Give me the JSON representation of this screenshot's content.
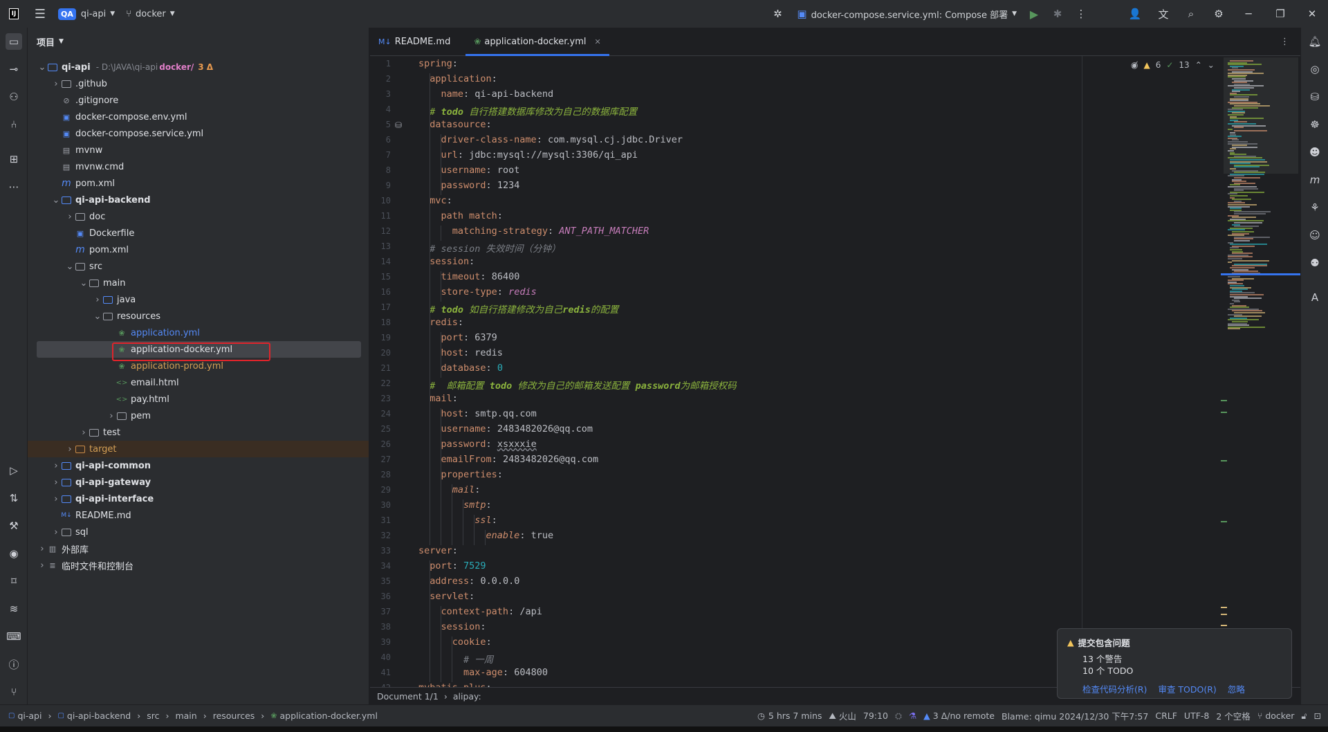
{
  "titlebar": {
    "project_badge": "QA",
    "project_name": "qi-api",
    "branch": "docker",
    "run_config": "docker-compose.service.yml: Compose 部署"
  },
  "project_panel": {
    "title": "项目",
    "tree": [
      {
        "label": "qi-api",
        "suffix": "- D:\\JAVA\\qi-api",
        "branch": "docker/",
        "delta": "3 Δ",
        "depth": 0,
        "expanded": true,
        "kind": "module"
      },
      {
        "label": ".github",
        "depth": 1,
        "kind": "folder"
      },
      {
        "label": ".gitignore",
        "depth": 1,
        "kind": "ignore"
      },
      {
        "label": "docker-compose.env.yml",
        "depth": 1,
        "kind": "docker"
      },
      {
        "label": "docker-compose.service.yml",
        "depth": 1,
        "kind": "docker"
      },
      {
        "label": "mvnw",
        "depth": 1,
        "kind": "shell"
      },
      {
        "label": "mvnw.cmd",
        "depth": 1,
        "kind": "shell"
      },
      {
        "label": "pom.xml",
        "depth": 1,
        "kind": "maven"
      },
      {
        "label": "qi-api-backend",
        "depth": 1,
        "expanded": true,
        "kind": "module"
      },
      {
        "label": "doc",
        "depth": 2,
        "kind": "folder"
      },
      {
        "label": "Dockerfile",
        "depth": 2,
        "kind": "docker"
      },
      {
        "label": "pom.xml",
        "depth": 2,
        "kind": "maven"
      },
      {
        "label": "src",
        "depth": 2,
        "expanded": true,
        "kind": "folder"
      },
      {
        "label": "main",
        "depth": 3,
        "expanded": true,
        "kind": "folder"
      },
      {
        "label": "java",
        "depth": 4,
        "kind": "folder-src"
      },
      {
        "label": "resources",
        "depth": 4,
        "expanded": true,
        "kind": "folder-res"
      },
      {
        "label": "application.yml",
        "depth": 5,
        "kind": "yml",
        "color": "blue"
      },
      {
        "label": "application-docker.yml",
        "depth": 5,
        "kind": "yml",
        "selected": true
      },
      {
        "label": "application-prod.yml",
        "depth": 5,
        "kind": "yml",
        "color": "orange"
      },
      {
        "label": "email.html",
        "depth": 5,
        "kind": "html"
      },
      {
        "label": "pay.html",
        "depth": 5,
        "kind": "html"
      },
      {
        "label": "pem",
        "depth": 5,
        "kind": "folder"
      },
      {
        "label": "test",
        "depth": 3,
        "kind": "folder"
      },
      {
        "label": "target",
        "depth": 2,
        "kind": "folder-excluded",
        "color": "orange"
      },
      {
        "label": "qi-api-common",
        "depth": 1,
        "kind": "module"
      },
      {
        "label": "qi-api-gateway",
        "depth": 1,
        "kind": "module"
      },
      {
        "label": "qi-api-interface",
        "depth": 1,
        "kind": "module"
      },
      {
        "label": "README.md",
        "depth": 1,
        "kind": "md"
      },
      {
        "label": "sql",
        "depth": 1,
        "kind": "folder"
      },
      {
        "label": "外部库",
        "depth": 0,
        "kind": "lib"
      },
      {
        "label": "临时文件和控制台",
        "depth": 0,
        "kind": "scratch"
      }
    ]
  },
  "tabs": [
    {
      "label": "README.md",
      "icon": "M↓",
      "active": false
    },
    {
      "label": "application-docker.yml",
      "icon": "yml",
      "active": true
    }
  ],
  "inspection": {
    "warnings": "6",
    "ok": "13"
  },
  "code_lines": [
    "spring:",
    "  application:",
    "    name: qi-api-backend",
    "  # todo 自行搭建数据库修改为自己的数据库配置",
    "  datasource:",
    "    driver-class-name: com.mysql.cj.jdbc.Driver",
    "    url: jdbc:mysql://mysql:3306/qi_api",
    "    username: root",
    "    password: 1234",
    "  mvc:",
    "    path match:",
    "      matching-strategy: ANT_PATH_MATCHER",
    "  # session 失效时间（分钟）",
    "  session:",
    "    timeout: 86400",
    "    store-type: redis",
    "  # todo 如自行搭建修改为自己redis的配置",
    "  redis:",
    "    port: 6379",
    "    host: redis",
    "    database: 0",
    "  #  邮箱配置 todo 修改为自己的邮箱发送配置 password为邮箱授权码",
    "  mail:",
    "    host: smtp.qq.com",
    "    username: 2483482026@qq.com",
    "    password: xsxxxie",
    "    emailFrom: 2483482026@qq.com",
    "    properties:",
    "      mail:",
    "        smtp:",
    "          ssl:",
    "            enable: true",
    "server:",
    "  port: 7529",
    "  address: 0.0.0.0",
    "  servlet:",
    "    context-path: /api",
    "    session:",
    "      cookie:",
    "        # 一周",
    "        max-age: 604800",
    "mybatis-plus:"
  ],
  "editor_breadcrumb": {
    "doc": "Document 1/1",
    "path": "alipay:"
  },
  "notification": {
    "title": "提交包含问题",
    "line1": "13 个警告",
    "line2": "10 个 TODO",
    "link1": "检查代码分析(R)",
    "link2": "审查 TODO(R)",
    "link3": "忽略"
  },
  "statusbar": {
    "crumbs": [
      "qi-api",
      "qi-api-backend",
      "src",
      "main",
      "resources",
      "application-docker.yml"
    ],
    "time": "5 hrs 7 mins",
    "plugin": "火山",
    "position": "79:10",
    "vcs": "3 Δ/no remote",
    "blame": "Blame: qimu 2024/12/30 下午7:57",
    "line_sep": "CRLF",
    "encoding": "UTF-8",
    "indent": "2 个空格",
    "branch": "docker"
  }
}
